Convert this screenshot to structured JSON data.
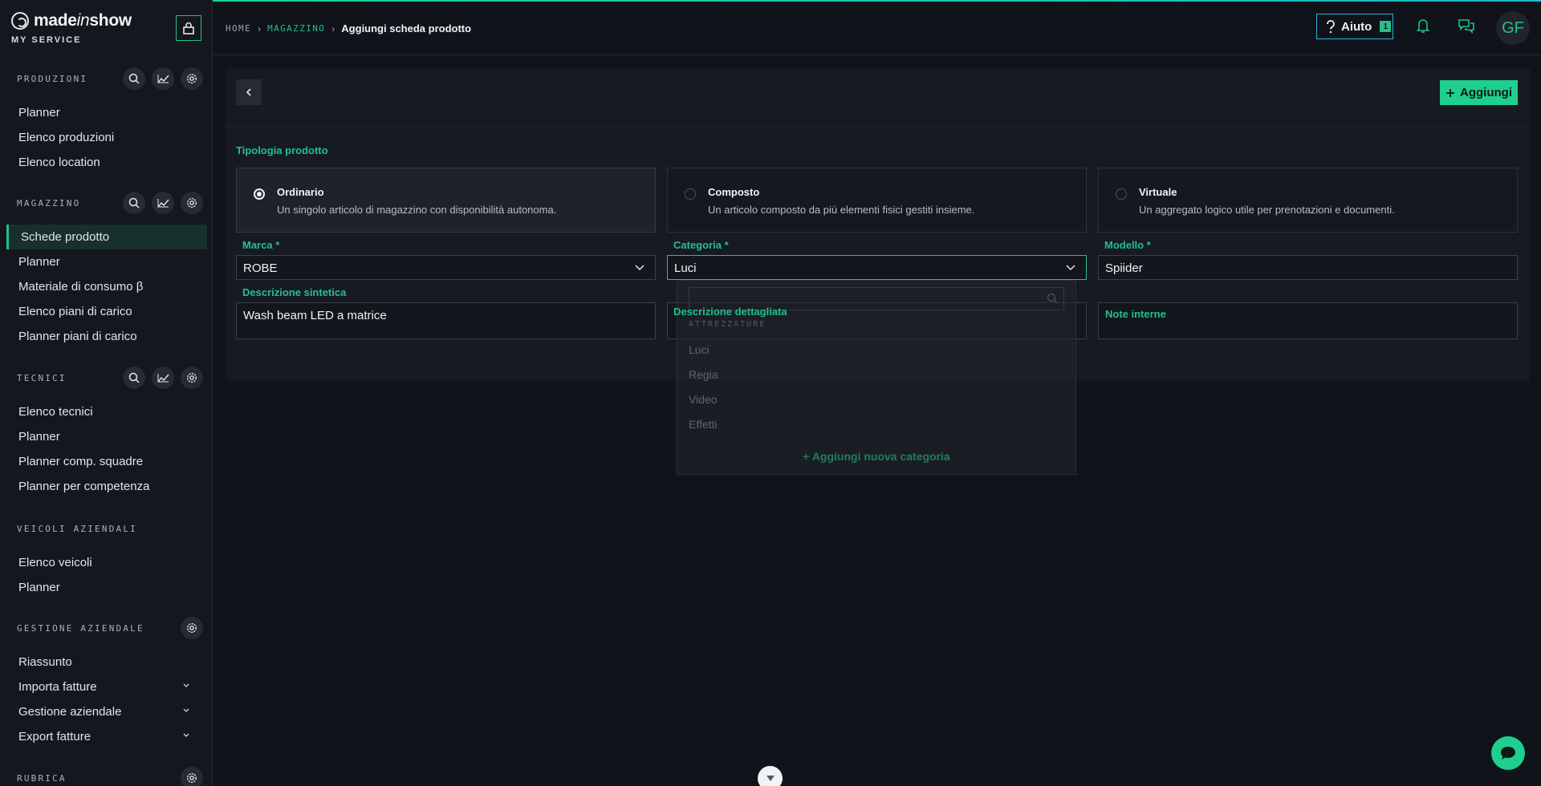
{
  "brand": {
    "name_pre": "made",
    "name_italic": "in",
    "name_post": "show",
    "subtitle": "MY SERVICE"
  },
  "sidebar": {
    "sections": [
      {
        "title": "PRODUZIONI",
        "items": [
          "Planner",
          "Elenco produzioni",
          "Elenco location"
        ]
      },
      {
        "title": "MAGAZZINO",
        "items": [
          "Schede prodotto",
          "Planner",
          "Materiale di consumo β",
          "Elenco piani di carico",
          "Planner piani di carico"
        ]
      },
      {
        "title": "TECNICI",
        "items": [
          "Elenco tecnici",
          "Planner",
          "Planner comp. squadre",
          "Planner per competenza"
        ]
      },
      {
        "title": "VEICOLI AZIENDALI",
        "items": [
          "Elenco veicoli",
          "Planner"
        ]
      },
      {
        "title": "GESTIONE AZIENDALE",
        "items": [
          "Riassunto",
          "Importa fatture",
          "Gestione aziendale",
          "Export fatture"
        ]
      },
      {
        "title": "RUBRICA",
        "items": []
      }
    ]
  },
  "breadcrumb": {
    "home": "HOME",
    "section": "MAGAZZINO",
    "current": "Aggiungi scheda prodotto"
  },
  "topbar": {
    "help_label": "Aiuto",
    "help_badge": "1",
    "avatar_initials": "GF"
  },
  "form": {
    "add_label": "Aggiungi",
    "type_label": "Tipologia prodotto",
    "types": [
      {
        "title": "Ordinario",
        "desc": "Un singolo articolo di magazzino con disponibilità autonoma."
      },
      {
        "title": "Composto",
        "desc": "Un articolo composto da più elementi fisici gestiti insieme."
      },
      {
        "title": "Virtuale",
        "desc": "Un aggregato logico utile per prenotazioni e documenti."
      }
    ],
    "selected_type": "Ordinario",
    "marca_label": "Marca *",
    "marca_value": "ROBE",
    "categoria_label": "Categoria *",
    "categoria_value": "Luci",
    "modello_label": "Modello *",
    "modello_value": "Spiider",
    "desc_sint_label": "Descrizione sintetica",
    "desc_sint_value": "Wash beam LED a matrice",
    "desc_det_label": "Descrizione dettagliata",
    "note_label": "Note interne"
  },
  "dropdown": {
    "group": "ATTREZZATURE",
    "items": [
      "Luci",
      "Regia",
      "Video",
      "Effetti"
    ],
    "add_label": "Aggiungi nuova categoria"
  },
  "colors": {
    "accent": "#22c08a",
    "background": "#10131a",
    "help_border": "#2bb3d9"
  }
}
